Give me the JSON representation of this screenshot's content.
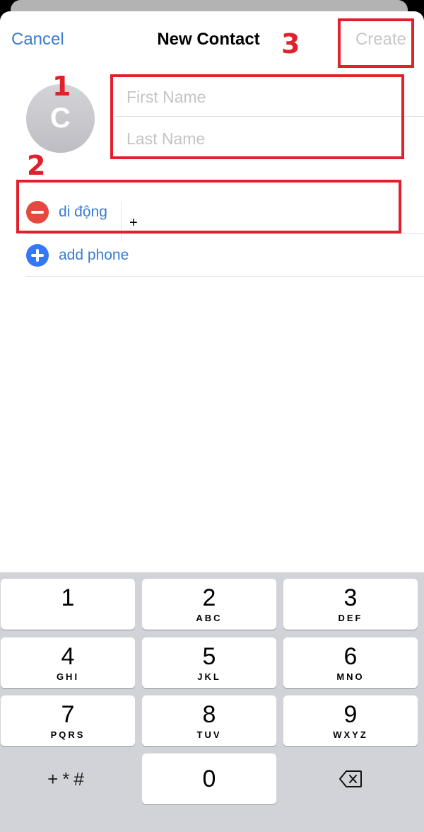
{
  "nav": {
    "cancel_label": "Cancel",
    "title": "New Contact",
    "create_label": "Create"
  },
  "avatar": {
    "initial": "C"
  },
  "name_fields": {
    "first_placeholder": "First Name",
    "last_placeholder": "Last Name"
  },
  "phone": {
    "label": "di động",
    "value": "+",
    "add_label": "add phone"
  },
  "annotations": [
    "1",
    "2",
    "3"
  ],
  "keypad": {
    "keys": [
      {
        "digit": "1",
        "letters": ""
      },
      {
        "digit": "2",
        "letters": "ABC"
      },
      {
        "digit": "3",
        "letters": "DEF"
      },
      {
        "digit": "4",
        "letters": "GHI"
      },
      {
        "digit": "5",
        "letters": "JKL"
      },
      {
        "digit": "6",
        "letters": "MNO"
      },
      {
        "digit": "7",
        "letters": "PQRS"
      },
      {
        "digit": "8",
        "letters": "TUV"
      },
      {
        "digit": "9",
        "letters": "WXYZ"
      },
      {
        "digit": "0",
        "letters": ""
      }
    ],
    "symbols_label": "+*#"
  },
  "colors": {
    "accent": "#3a7bd5",
    "delete_red": "#e5493d",
    "add_blue": "#3478f6",
    "annotation_red": "#e0202a"
  }
}
